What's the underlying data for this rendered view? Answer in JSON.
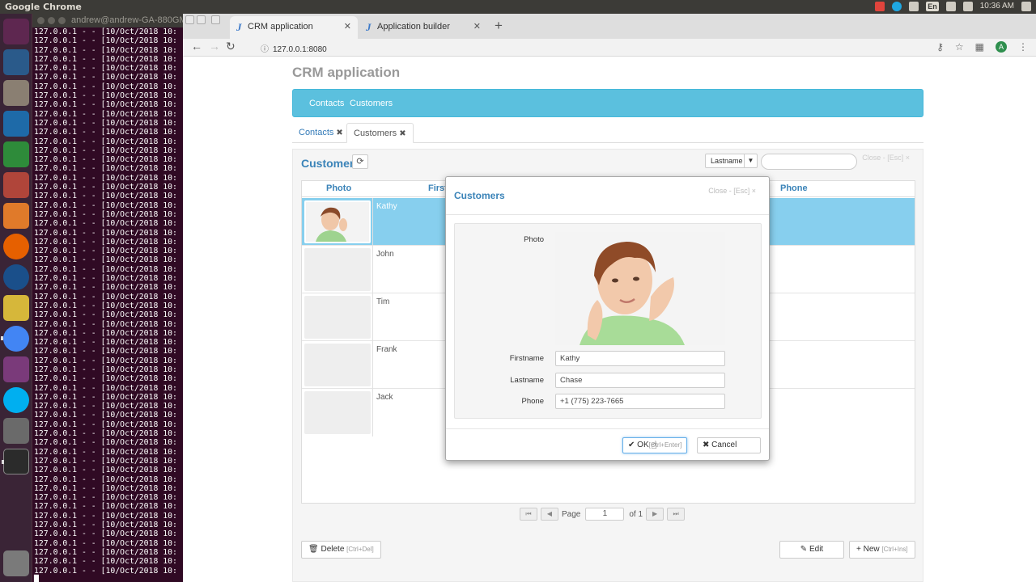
{
  "system": {
    "app_title": "Google Chrome",
    "clock": "10:36 AM",
    "lang": "En"
  },
  "terminal": {
    "title": "andrew@andrew-GA-880GM",
    "log_line": "127.0.0.1 - - [10/Oct/2018 10:"
  },
  "browser": {
    "tabs": [
      {
        "label": "CRM application",
        "icon": "J",
        "active": true
      },
      {
        "label": "Application builder",
        "icon": "J",
        "active": false
      }
    ],
    "url": "127.0.0.1:8080",
    "avatar_letter": "A"
  },
  "page": {
    "title": "CRM application",
    "nav": [
      "Contacts",
      "Customers"
    ],
    "tabs": [
      {
        "label": "Contacts",
        "active": false
      },
      {
        "label": "Customers",
        "active": true
      }
    ]
  },
  "grid": {
    "title": "Customers",
    "close_hint": "Close - [Esc] ×",
    "sort_field": "Lastname",
    "columns": [
      "Photo",
      "First",
      "Phone"
    ],
    "rows": [
      {
        "firstname": "Kathy",
        "selected": true
      },
      {
        "firstname": "John",
        "selected": false
      },
      {
        "firstname": "Tim",
        "selected": false
      },
      {
        "firstname": "Frank",
        "selected": false
      },
      {
        "firstname": "Jack",
        "selected": false
      }
    ],
    "pager": {
      "page_label": "Page",
      "page": "1",
      "of_label": "of 1"
    },
    "actions": {
      "delete_label": "Delete",
      "delete_hint": "[Ctrl+Del]",
      "edit_label": "Edit",
      "new_label": "New",
      "new_hint": "[Ctrl+Ins]"
    }
  },
  "modal": {
    "title": "Customers",
    "close_hint": "Close - [Esc] ×",
    "labels": {
      "photo": "Photo",
      "firstname": "Firstname",
      "lastname": "Lastname",
      "phone": "Phone"
    },
    "values": {
      "firstname": "Kathy",
      "lastname": "Chase",
      "phone": "+1 (775) 223-7665"
    },
    "ok_label": "OK",
    "ok_hint": "[Ctrl+Enter]",
    "cancel_label": "Cancel"
  },
  "colors": {
    "accent": "#3a83b8",
    "navbar": "#5bc0de",
    "selected_row": "#87cfee"
  }
}
